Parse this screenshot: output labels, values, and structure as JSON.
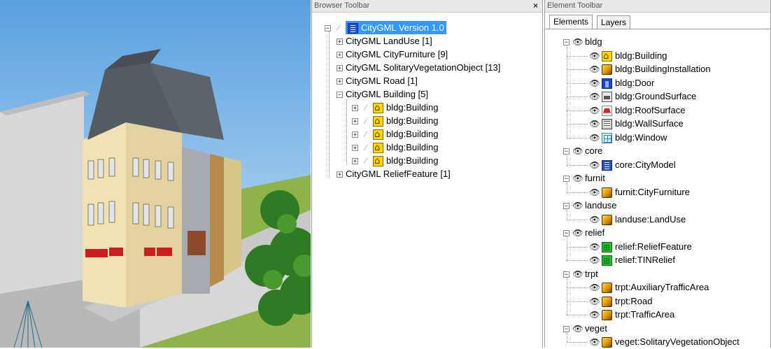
{
  "browser_toolbar": {
    "title": "Browser Toolbar",
    "close": "×",
    "root": "CityGML Version 1.0",
    "items": [
      {
        "label": "CityGML LandUse [1]"
      },
      {
        "label": "CityGML CityFurniture [9]"
      },
      {
        "label": "CityGML SolitaryVegetationObject [13]"
      },
      {
        "label": "CityGML Road [1]"
      },
      {
        "label": "CityGML Building [5]"
      },
      {
        "label": "CityGML ReliefFeature [1]"
      }
    ],
    "buildings": [
      "bldg:Building",
      "bldg:Building",
      "bldg:Building",
      "bldg:Building",
      "bldg:Building"
    ]
  },
  "element_toolbar": {
    "title": "Element Toolbar",
    "tabs": [
      "Elements",
      "Layers"
    ],
    "groups": [
      {
        "name": "bldg",
        "items": [
          {
            "label": "bldg:Building",
            "icon": "building-icon"
          },
          {
            "label": "bldg:BuildingInstallation",
            "icon": "cube-icon"
          },
          {
            "label": "bldg:Door",
            "icon": "door-icon"
          },
          {
            "label": "bldg:GroundSurface",
            "icon": "ground-surface-icon"
          },
          {
            "label": "bldg:RoofSurface",
            "icon": "roof-surface-icon"
          },
          {
            "label": "bldg:WallSurface",
            "icon": "wall-surface-icon"
          },
          {
            "label": "bldg:Window",
            "icon": "window-icon"
          }
        ]
      },
      {
        "name": "core",
        "items": [
          {
            "label": "core:CityModel",
            "icon": "city-model-icon"
          }
        ]
      },
      {
        "name": "furnit",
        "items": [
          {
            "label": "furnit:CityFurniture",
            "icon": "cube-icon"
          }
        ]
      },
      {
        "name": "landuse",
        "items": [
          {
            "label": "landuse:LandUse",
            "icon": "cube-icon"
          }
        ]
      },
      {
        "name": "relief",
        "items": [
          {
            "label": "relief:ReliefFeature",
            "icon": "relief-icon"
          },
          {
            "label": "relief:TINRelief",
            "icon": "relief-icon"
          }
        ]
      },
      {
        "name": "trpt",
        "items": [
          {
            "label": "trpt:AuxiliaryTrafficArea",
            "icon": "cube-icon"
          },
          {
            "label": "trpt:Road",
            "icon": "cube-icon"
          },
          {
            "label": "trpt:TrafficArea",
            "icon": "cube-icon"
          }
        ]
      },
      {
        "name": "veget",
        "items": [
          {
            "label": "veget:SolitaryVegetationObject",
            "icon": "cube-icon"
          }
        ]
      }
    ]
  },
  "colors": {
    "selection": "#3399ff",
    "sky": "#7db9e8",
    "grass": "#7aa53a"
  }
}
